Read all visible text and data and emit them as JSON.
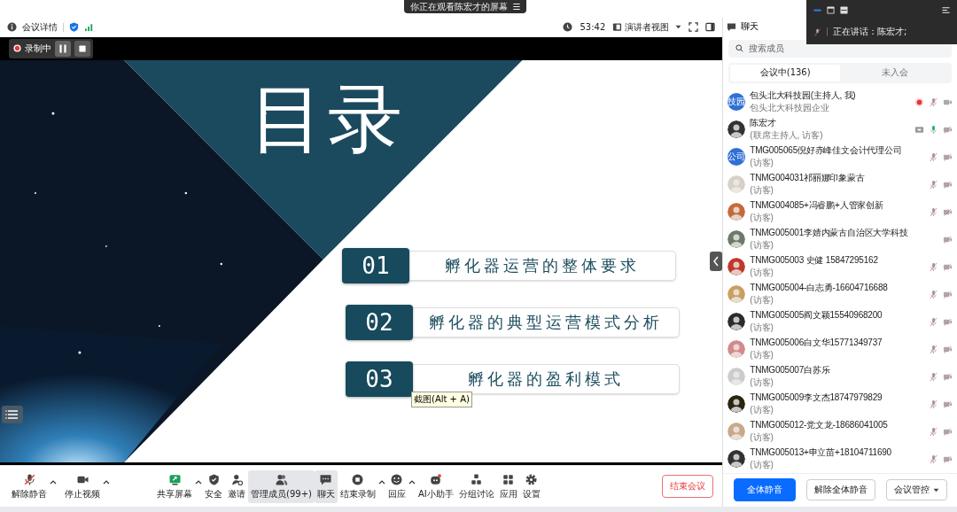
{
  "banner": {
    "text": "你正在观看陈宏才的屏幕",
    "icon": "☰"
  },
  "speaking_panel": {
    "text": "正在讲话：陈宏才;"
  },
  "info_bar": {
    "details": "会议详情",
    "timer": "53:42",
    "view": "演讲者视图"
  },
  "recording": {
    "label": "录制中"
  },
  "slide": {
    "title": "目录",
    "items": [
      {
        "number": "01",
        "text": "孵化器运营的整体要求"
      },
      {
        "number": "02",
        "text": "孵化器的典型运营模式分析"
      },
      {
        "number": "03",
        "text": "孵化器的盈利模式"
      }
    ]
  },
  "tooltip": "截图(Alt + A)",
  "panel": {
    "title": "聊天",
    "search": {
      "placeholder": "搜索成员"
    },
    "tabs": [
      {
        "label": "会议中(136)",
        "selected": true
      },
      {
        "label": "未入会",
        "selected": false
      }
    ],
    "members": [
      {
        "name": "包头北大科技园(主持人, 我)",
        "role": "包头北大科技园企业",
        "avatar": {
          "kind": "text",
          "text": "技园"
        },
        "recording": true,
        "sharing": false,
        "mic_shown": true,
        "mic_muted": true,
        "camera_off": false
      },
      {
        "name": "陈宏才",
        "role": "(联席主持人, 访客)",
        "recording": false,
        "sharing": true,
        "mic_shown": true,
        "mic_muted": false,
        "camera_off": true
      },
      {
        "name": "TMG005065倪好赤峰佳文会计代理公司",
        "role": "(访客)",
        "avatar": {
          "kind": "text",
          "text": "公司"
        },
        "recording": false,
        "sharing": false,
        "mic_shown": true,
        "mic_muted": true,
        "camera_off": true
      },
      {
        "name": "TNMG004031祁丽娜印象蒙古",
        "role": "(访客)",
        "recording": false,
        "sharing": false,
        "mic_shown": true,
        "mic_muted": true,
        "camera_off": true
      },
      {
        "name": "TNMG004085+冯睿鹏+人管家创新",
        "role": "(访客)",
        "recording": false,
        "sharing": false,
        "mic_shown": true,
        "mic_muted": true,
        "camera_off": true
      },
      {
        "name": "TNMG005001李婧内蒙古自治区大学科技",
        "role": "(访客)",
        "recording": false,
        "sharing": false,
        "mic_shown": false,
        "camera_off": true
      },
      {
        "name": "TNMG005003 史健 15847295162",
        "role": "(访客)",
        "recording": false,
        "sharing": false,
        "mic_shown": true,
        "mic_muted": true,
        "camera_off": true
      },
      {
        "name": "TNMG005004-白志勇-16604716688",
        "role": "(访客)",
        "recording": false,
        "sharing": false,
        "mic_shown": true,
        "mic_muted": true,
        "camera_off": true
      },
      {
        "name": "TNMG005005阎文颖15540968200",
        "role": "(访客)",
        "recording": false,
        "sharing": false,
        "mic_shown": true,
        "mic_muted": true,
        "camera_off": true
      },
      {
        "name": "TNMG005006白文华15771349737",
        "role": "(访客)",
        "recording": false,
        "sharing": false,
        "mic_shown": true,
        "mic_muted": true,
        "camera_off": true
      },
      {
        "name": "TNMG005007白苏乐",
        "role": "(访客)",
        "recording": false,
        "sharing": false,
        "mic_shown": true,
        "mic_muted": true,
        "camera_off": true
      },
      {
        "name": "TNMG005009李文杰18747979829",
        "role": "(访客)",
        "recording": false,
        "sharing": false,
        "mic_shown": true,
        "mic_muted": true,
        "camera_off": true
      },
      {
        "name": "TNMG005012-党文龙-18686041005",
        "role": "(访客)",
        "recording": false,
        "sharing": false,
        "mic_shown": true,
        "mic_muted": true,
        "camera_off": true
      },
      {
        "name": "TNMG005013+申立苗+18104711690",
        "role": "(访客)",
        "recording": false,
        "sharing": false,
        "mic_shown": true,
        "mic_muted": true,
        "camera_off": true
      }
    ],
    "footer": [
      {
        "label": "全体静音",
        "kind": "primary"
      },
      {
        "label": "解除全体静音",
        "kind": "plain"
      },
      {
        "label": "会议管控",
        "kind": "dropdown"
      }
    ]
  },
  "toolbar": {
    "left": [
      {
        "label": "解除静音",
        "kind": "mic",
        "menu": true,
        "selected": false
      },
      {
        "label": "停止视频",
        "kind": "video",
        "menu": true,
        "selected": false
      }
    ],
    "center": [
      {
        "label": "共享屏幕",
        "kind": "share",
        "menu": true,
        "selected": false
      },
      {
        "label": "安全",
        "kind": "shield",
        "menu": false,
        "selected": false
      },
      {
        "label": "邀请",
        "kind": "invite",
        "menu": false,
        "selected": false
      },
      {
        "label": "管理成员(99+)",
        "kind": "members",
        "menu": false,
        "selected": true
      },
      {
        "label": "聊天",
        "kind": "chat",
        "menu": false,
        "selected": true
      },
      {
        "label": "结束录制",
        "kind": "record",
        "menu": true,
        "selected": false
      },
      {
        "label": "回应",
        "kind": "react",
        "menu": true,
        "selected": false
      },
      {
        "label": "AI小助手",
        "kind": "ai",
        "menu": false,
        "selected": false
      },
      {
        "label": "分组讨论",
        "kind": "breakout",
        "menu": false,
        "selected": false
      },
      {
        "label": "应用",
        "kind": "apps",
        "menu": false,
        "selected": false
      },
      {
        "label": "设置",
        "kind": "settings",
        "menu": false,
        "selected": false
      }
    ],
    "end": "结束会议"
  }
}
